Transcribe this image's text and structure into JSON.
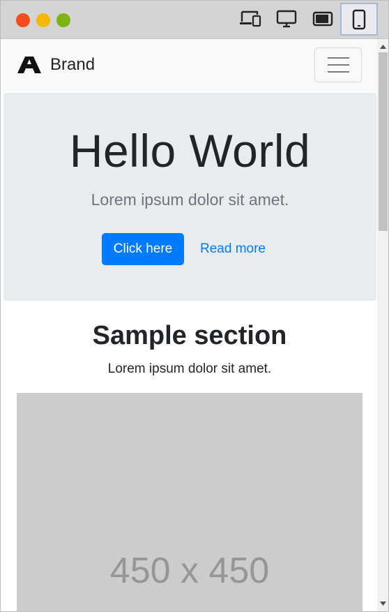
{
  "window": {
    "controls": [
      "close",
      "minimize",
      "maximize"
    ],
    "device_modes": [
      {
        "icon": "responsive-devices-icon",
        "active": false
      },
      {
        "icon": "desktop-monitor-icon",
        "active": false
      },
      {
        "icon": "tablet-landscape-icon",
        "active": false
      },
      {
        "icon": "mobile-phone-icon",
        "active": true
      }
    ]
  },
  "navbar": {
    "brand_icon": "brand-logo-icon",
    "brand": "Brand",
    "toggler_icon": "hamburger-menu-icon"
  },
  "hero": {
    "title": "Hello World",
    "lead": "Lorem ipsum dolor sit amet.",
    "primary_button": "Click here",
    "secondary_link": "Read more"
  },
  "section": {
    "title": "Sample section",
    "text": "Lorem ipsum dolor sit amet.",
    "image_placeholder": "450 x 450"
  },
  "colors": {
    "primary": "#007bff",
    "navbar_bg": "#f8f9fa",
    "jumbotron_bg": "#e9ecef",
    "placeholder_bg": "#cccccc"
  }
}
